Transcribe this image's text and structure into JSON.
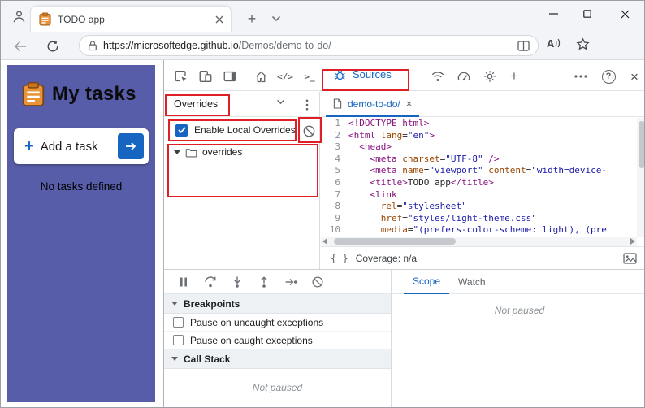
{
  "colors": {
    "accent": "#1665c0",
    "page_purple": "#575da8",
    "annotation_red": "#e01e26",
    "code_tag": "#881280",
    "code_attr": "#994500",
    "code_value": "#1a1aa6"
  },
  "icons": {
    "plus": "+",
    "help": "?",
    "close": "×",
    "code_tool": "</>",
    "console_tool": ">_",
    "braces": "{ }",
    "read_aloud": "A"
  },
  "browser": {
    "tab": {
      "title": "TODO app"
    },
    "address": {
      "scheme_host": "https://microsoftedge.github.io",
      "path": "/Demos/demo-to-do/"
    }
  },
  "page": {
    "title": "My tasks",
    "add_task": "Add a task",
    "empty": "No tasks defined"
  },
  "devtools": {
    "toolbar": {
      "sources_label": "Sources"
    },
    "sidebar": {
      "pane": "Overrides",
      "enable": "Enable Local Overrides",
      "folder": "overrides"
    },
    "editor": {
      "tab": "demo-to-do/",
      "coverage": "Coverage: n/a",
      "lines": [
        {
          "n": "1",
          "seg": [
            [
              "t",
              "<!DOCTYPE html>"
            ]
          ]
        },
        {
          "n": "2",
          "seg": [
            [
              "t",
              "<html"
            ],
            [
              "p",
              " "
            ],
            [
              "a",
              "lang"
            ],
            [
              "p",
              "="
            ],
            [
              "v",
              "\"en\""
            ],
            [
              "t",
              ">"
            ]
          ]
        },
        {
          "n": "3",
          "seg": [
            [
              "p",
              "  "
            ],
            [
              "t",
              "<head>"
            ]
          ]
        },
        {
          "n": "4",
          "seg": [
            [
              "p",
              "    "
            ],
            [
              "t",
              "<meta"
            ],
            [
              "p",
              " "
            ],
            [
              "a",
              "charset"
            ],
            [
              "p",
              "="
            ],
            [
              "v",
              "\"UTF-8\""
            ],
            [
              "p",
              " "
            ],
            [
              "t",
              "/>"
            ]
          ]
        },
        {
          "n": "5",
          "seg": [
            [
              "p",
              "    "
            ],
            [
              "t",
              "<meta"
            ],
            [
              "p",
              " "
            ],
            [
              "a",
              "name"
            ],
            [
              "p",
              "="
            ],
            [
              "v",
              "\"viewport\""
            ],
            [
              "p",
              " "
            ],
            [
              "a",
              "content"
            ],
            [
              "p",
              "="
            ],
            [
              "v",
              "\"width=device-"
            ]
          ]
        },
        {
          "n": "6",
          "seg": [
            [
              "p",
              "    "
            ],
            [
              "t",
              "<title>"
            ],
            [
              "x",
              "TODO app"
            ],
            [
              "t",
              "</title>"
            ]
          ]
        },
        {
          "n": "7",
          "seg": [
            [
              "p",
              "    "
            ],
            [
              "t",
              "<link"
            ]
          ]
        },
        {
          "n": "8",
          "seg": [
            [
              "p",
              "      "
            ],
            [
              "a",
              "rel"
            ],
            [
              "p",
              "="
            ],
            [
              "v",
              "\"stylesheet\""
            ]
          ]
        },
        {
          "n": "9",
          "seg": [
            [
              "p",
              "      "
            ],
            [
              "a",
              "href"
            ],
            [
              "p",
              "="
            ],
            [
              "v",
              "\"styles/light-theme.css\""
            ]
          ]
        },
        {
          "n": "10",
          "seg": [
            [
              "p",
              "      "
            ],
            [
              "a",
              "media"
            ],
            [
              "p",
              "="
            ],
            [
              "v",
              "\"(prefers-color-scheme: light), (pre"
            ]
          ]
        }
      ]
    },
    "debugger": {
      "breakpoints_header": "Breakpoints",
      "pause_uncaught": "Pause on uncaught exceptions",
      "pause_caught": "Pause on caught exceptions",
      "callstack_header": "Call Stack",
      "not_paused": "Not paused",
      "scope": "Scope",
      "watch": "Watch"
    }
  }
}
